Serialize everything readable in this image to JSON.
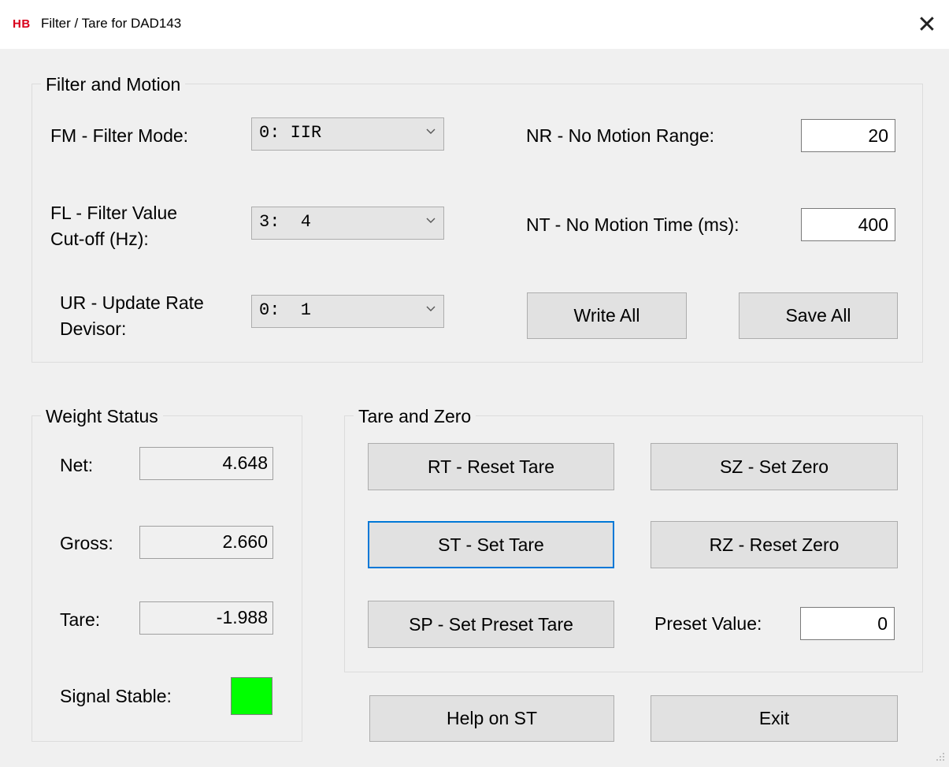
{
  "window": {
    "logo_text": "HB",
    "title": "Filter / Tare for DAD143",
    "close_glyph": "✕",
    "accent_color": "#d9001b"
  },
  "filter_motion": {
    "caption": "Filter and Motion",
    "fm_label": "FM - Filter Mode:",
    "fm_value": "0: IIR",
    "fl_label_line1": "FL - Filter Value",
    "fl_label_line2": "Cut-off (Hz):",
    "fl_value": "3:  4",
    "ur_label_line1": "UR - Update Rate",
    "ur_label_line2": "Devisor:",
    "ur_value": "0:  1",
    "nr_label": "NR - No Motion Range:",
    "nr_value": "20",
    "nt_label": "NT - No Motion Time (ms):",
    "nt_value": "400",
    "write_all": "Write All",
    "save_all": "Save All"
  },
  "weight_status": {
    "caption": "Weight Status",
    "net_label": "Net:",
    "net_value": "4.648",
    "gross_label": "Gross:",
    "gross_value": "2.660",
    "tare_label": "Tare:",
    "tare_value": "-1.988",
    "stable_label": "Signal Stable:",
    "stable_color": "#00ff00"
  },
  "tare_zero": {
    "caption": "Tare and Zero",
    "rt_button": "RT - Reset Tare",
    "sz_button": "SZ - Set Zero",
    "st_button": "ST - Set Tare",
    "rz_button": "RZ - Reset Zero",
    "sp_button": "SP - Set Preset Tare",
    "preset_label": "Preset Value:",
    "preset_value": "0"
  },
  "footer": {
    "help_button": "Help on ST",
    "exit_button": "Exit"
  }
}
